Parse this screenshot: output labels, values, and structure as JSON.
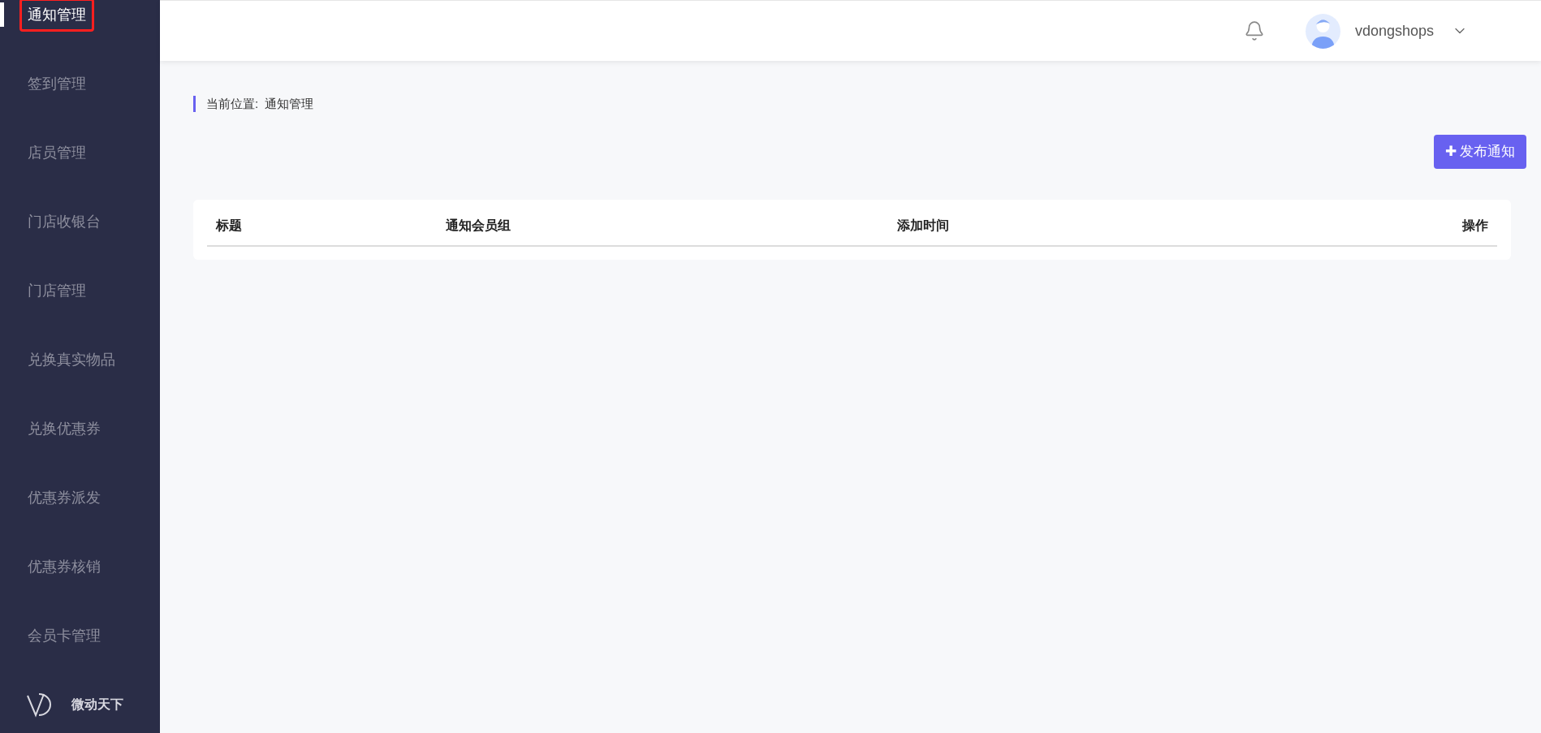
{
  "sidebar": {
    "items": [
      {
        "label": "通知管理",
        "selected": true,
        "annotated": true
      },
      {
        "label": "签到管理",
        "selected": false,
        "annotated": false
      },
      {
        "label": "店员管理",
        "selected": false,
        "annotated": false
      },
      {
        "label": "门店收银台",
        "selected": false,
        "annotated": false
      },
      {
        "label": "门店管理",
        "selected": false,
        "annotated": false
      },
      {
        "label": "兑换真实物品",
        "selected": false,
        "annotated": false
      },
      {
        "label": "兑换优惠券",
        "selected": false,
        "annotated": false
      },
      {
        "label": "优惠券派发",
        "selected": false,
        "annotated": false
      },
      {
        "label": "优惠券核销",
        "selected": false,
        "annotated": false
      },
      {
        "label": "会员卡管理",
        "selected": false,
        "annotated": false
      }
    ],
    "brand": "微动天下"
  },
  "header": {
    "username": "vdongshops"
  },
  "breadcrumb": {
    "label": "当前位置:",
    "current": "通知管理"
  },
  "publish_button": {
    "icon": "✚",
    "label": "发布通知"
  },
  "table": {
    "columns": [
      "标题",
      "通知会员组",
      "添加时间",
      "操作"
    ]
  }
}
